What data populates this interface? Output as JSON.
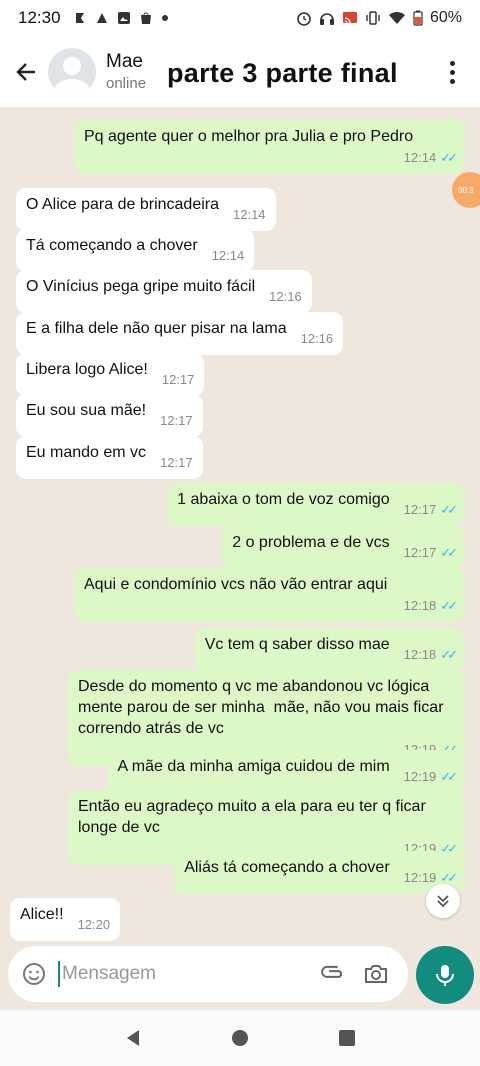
{
  "status_bar": {
    "time": "12:30",
    "battery": "60%",
    "left_icons": [
      "notification-icon",
      "app-icon",
      "image-icon",
      "shop-icon",
      "dot-icon"
    ],
    "right_icons": [
      "alarm-icon",
      "headset-icon",
      "cast-icon",
      "vibrate-icon",
      "wifi-icon",
      "battery-icon"
    ]
  },
  "header": {
    "contact_name": "Mae",
    "contact_status": "online",
    "overlay_title": "parte 3 parte final"
  },
  "overlay_bubble": "00:3",
  "messages": [
    {
      "dir": "out",
      "text": "Pq agente quer o melhor pra Julia e pro Pedro",
      "time": "12:14",
      "read": true
    },
    {
      "dir": "in",
      "text": "O Alice para de brincadeira",
      "time": "12:14"
    },
    {
      "dir": "in",
      "text": "Tá começando a chover",
      "time": "12:14"
    },
    {
      "dir": "in",
      "text": "O Vinícius pega gripe muito fácil",
      "time": "12:16"
    },
    {
      "dir": "in",
      "text": "E a filha dele não quer pisar na lama",
      "time": "12:16"
    },
    {
      "dir": "in",
      "text": "Libera logo Alice!",
      "time": "12:17"
    },
    {
      "dir": "in",
      "text": "Eu sou sua mãe!",
      "time": "12:17"
    },
    {
      "dir": "in",
      "text": "Eu mando em vc",
      "time": "12:17"
    },
    {
      "dir": "out",
      "text": "1 abaixa o tom de voz comigo",
      "time": "12:17",
      "read": true
    },
    {
      "dir": "out",
      "text": "2 o problema e de vcs",
      "time": "12:17",
      "read": true
    },
    {
      "dir": "out",
      "text": "Aqui e condomínio vcs não vão entrar aqui",
      "time": "12:18",
      "read": true
    },
    {
      "dir": "out",
      "text": "Vc tem q saber disso mae",
      "time": "12:18",
      "read": true
    },
    {
      "dir": "out",
      "text": "Desde do momento q vc me abandonou vc lógica mente parou de ser minha  mãe, não vou mais ficar correndo atrás de vc",
      "time": "12:19",
      "read": true
    },
    {
      "dir": "out",
      "text": "A mãe da minha amiga cuidou de mim",
      "time": "12:19",
      "read": true
    },
    {
      "dir": "out",
      "text": "Então eu agradeço muito a ela para eu ter q ficar longe de vc",
      "time": "12:19",
      "read": true
    },
    {
      "dir": "out",
      "text": "Aliás tá começando a chover",
      "time": "12:19",
      "read": true
    },
    {
      "dir": "in",
      "text": "Alice!!",
      "time": "12:20"
    }
  ],
  "input": {
    "placeholder": "Mensagem"
  }
}
